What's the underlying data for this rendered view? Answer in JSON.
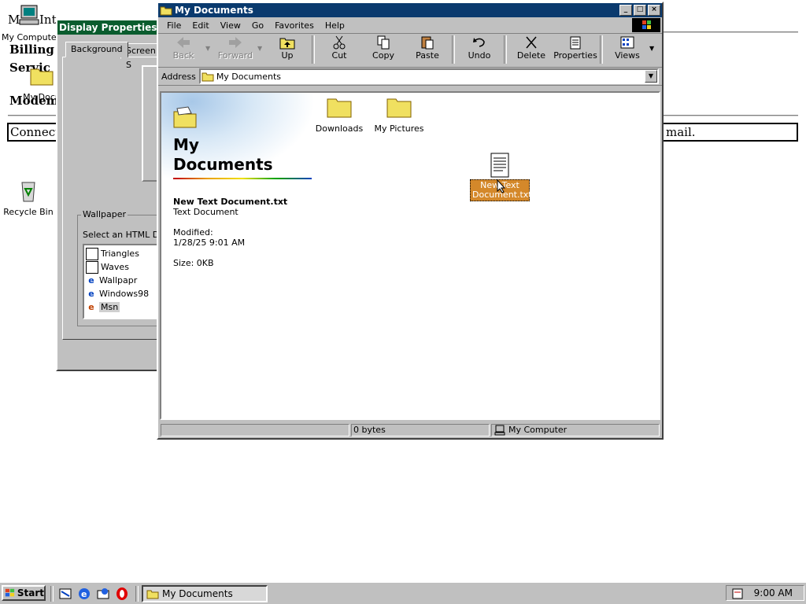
{
  "desktop": {
    "icons": [
      {
        "label": "My Computer"
      },
      {
        "label": "My Docu"
      },
      {
        "label": "Recycle Bin"
      }
    ],
    "web_page": {
      "heading_fragment": "M",
      "heading_fragment2": "Int",
      "billing": "Billing R",
      "service": "Servic",
      "modem": "Modem",
      "connect": "Connect w",
      "mail": "mail."
    }
  },
  "display_properties": {
    "title": "Display Properties",
    "tabs": [
      "Background",
      "Screen S"
    ],
    "wallpaper_group": "Wallpaper",
    "select_label": "Select an HTML Do",
    "items": [
      {
        "label": "Triangles",
        "icon": "wallpaper-icon"
      },
      {
        "label": "Waves",
        "icon": "wallpaper-icon"
      },
      {
        "label": "Wallpapr",
        "icon": "html-icon"
      },
      {
        "label": "Windows98",
        "icon": "html-icon"
      },
      {
        "label": "Msn",
        "icon": "html-icon",
        "selected": true
      }
    ]
  },
  "explorer": {
    "title": "My Documents",
    "menu": [
      {
        "label": "File",
        "key": "F"
      },
      {
        "label": "Edit",
        "key": "E"
      },
      {
        "label": "View",
        "key": "V"
      },
      {
        "label": "Go",
        "key": "G"
      },
      {
        "label": "Favorites",
        "key": "a"
      },
      {
        "label": "Help",
        "key": "H"
      }
    ],
    "toolbar": {
      "back": "Back",
      "forward": "Forward",
      "up": "Up",
      "cut": "Cut",
      "copy": "Copy",
      "paste": "Paste",
      "undo": "Undo",
      "delete": "Delete",
      "properties": "Properties",
      "views": "Views"
    },
    "address_label": "Address",
    "address_value": "My Documents",
    "info": {
      "title_line1": "My",
      "title_line2": "Documents",
      "file_name": "New Text Document.txt",
      "file_type": "Text Document",
      "modified_label": "Modified:",
      "modified_value": "1/28/25 9:01 AM",
      "size": "Size: 0KB"
    },
    "files": [
      {
        "label": "Downloads",
        "icon": "folder-icon"
      },
      {
        "label": "My Pictures",
        "icon": "folder-icon"
      },
      {
        "label_line1": "New Text",
        "label_line2": "Document.txt",
        "icon": "text-file-icon",
        "selected": true
      }
    ],
    "status": {
      "left": "",
      "size": "0 bytes",
      "location": "My Computer"
    }
  },
  "taskbar": {
    "start": "Start",
    "task": "My Documents",
    "clock": "9:00 AM"
  },
  "colors": {
    "display_title": "#0a5c2e",
    "explorer_title": "#0a3a6e",
    "selection": "#d4882a",
    "face": "#c0c0c0"
  }
}
